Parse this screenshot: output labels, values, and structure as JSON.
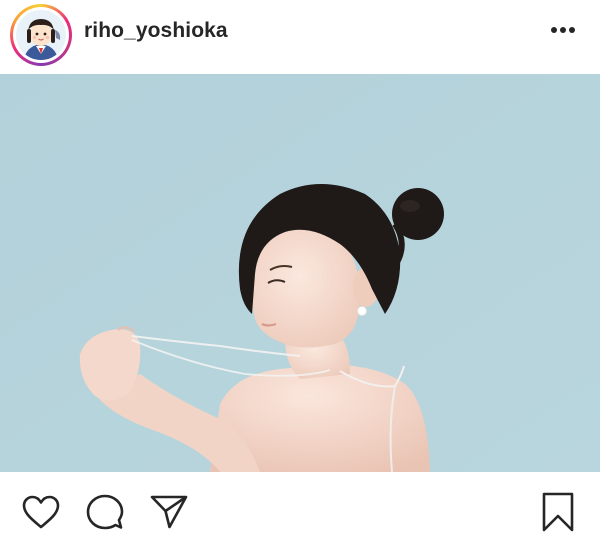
{
  "post": {
    "username": "riho_yoshioka",
    "avatar_icon": "profile-avatar",
    "more_icon": "more-horizontal-icon"
  },
  "actions": {
    "like_icon": "heart-icon",
    "comment_icon": "comment-icon",
    "share_icon": "paper-plane-icon",
    "save_icon": "bookmark-icon"
  },
  "colors": {
    "photo_background": "#b7d4dc",
    "text": "#262626",
    "story_ring_start": "#f9ce34",
    "story_ring_end": "#833ab4"
  }
}
